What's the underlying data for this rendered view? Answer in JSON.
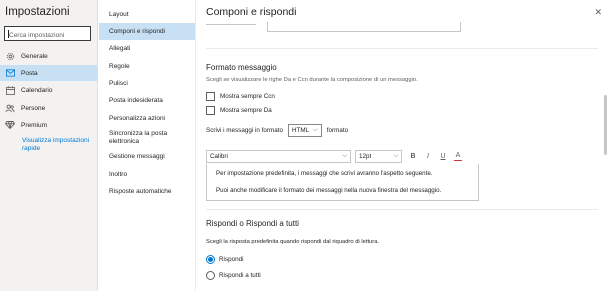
{
  "nav": {
    "title": "Impostazioni",
    "search_placeholder": "Cerca impostazioni",
    "items": [
      {
        "label": "Generale",
        "icon": "gear-icon"
      },
      {
        "label": "Posta",
        "icon": "mail-icon"
      },
      {
        "label": "Calendario",
        "icon": "calendar-icon"
      },
      {
        "label": "Persone",
        "icon": "people-icon"
      },
      {
        "label": "Premium",
        "icon": "diamond-icon"
      }
    ],
    "quick_link": "Visualizza impostazioni rapide"
  },
  "subnav": {
    "items": [
      "Layout",
      "Componi e rispondi",
      "Allegati",
      "Regole",
      "Pulisci",
      "Posta indesiderata",
      "Personalizza azioni",
      "Sincronizza la posta elettronica",
      "Gestione messaggi",
      "Inoltro",
      "Risposte automatiche"
    ],
    "active_index": 1
  },
  "main": {
    "title": "Componi e rispondi",
    "close_icon": "close-icon",
    "format": {
      "heading": "Formato messaggio",
      "description": "Scegli se visualizzare le righe Da e Ccn durante la composizione di un messaggio.",
      "checkbox_ccn": "Mostra sempre Ccn",
      "checkbox_da": "Mostra sempre Da",
      "compose_prefix": "Scrivi i messaggi in formato",
      "compose_value": "HTML",
      "compose_suffix": "formato"
    },
    "toolbar": {
      "font": "Calibri",
      "size": "12pt",
      "bold": "B",
      "italic": "I",
      "underline": "U",
      "color": "A"
    },
    "editor": {
      "line1": "Per impostazione predefinita, i messaggi che scrivi avranno l'aspetto seguente.",
      "line2": "Puoi anche modificare il formato dei messaggi nella nuova finestra del messaggio."
    },
    "reply": {
      "heading": "Rispondi o Rispondi a tutti",
      "description": "Scegli la risposta predefinita quando rispondi dal riquadro di lettura.",
      "option1": "Rispondi",
      "option2": "Rispondi a tutti",
      "selected": "Rispondi"
    }
  },
  "colors": {
    "accent": "#0078d4",
    "selected_bg": "#c7e0f4",
    "nav_bg": "#f3f2f1",
    "font_color_red": "#d13438"
  }
}
